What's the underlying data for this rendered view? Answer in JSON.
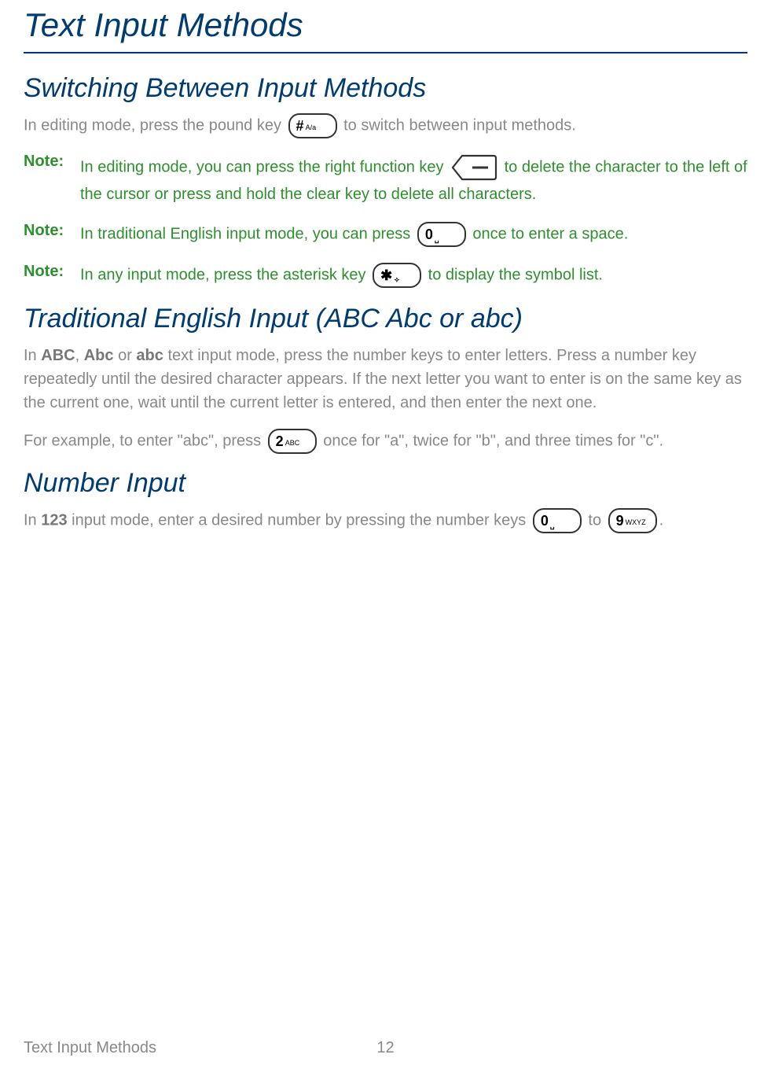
{
  "page": {
    "title": "Text Input Methods",
    "footer_title": "Text Input Methods",
    "page_number": "12"
  },
  "sections": {
    "switching": {
      "heading": "Switching Between Input Methods",
      "intro_pre": "In editing mode, press the pound key ",
      "intro_post": " to switch between input methods.",
      "note1_label": "Note:",
      "note1_pre": "In editing mode, you can press the right function key ",
      "note1_post": " to delete the character to the left of the cursor or press and hold the clear key to delete all characters.",
      "note2_label": "Note:",
      "note2_pre": "In traditional English input mode, you can press ",
      "note2_post": " once to enter a space.",
      "note3_label": "Note:",
      "note3_pre": "In any input mode, press the asterisk key ",
      "note3_post": " to display the symbol list."
    },
    "traditional": {
      "heading": "Traditional English Input (ABC Abc or abc)",
      "para1_pre": "In ",
      "para1_b1": "ABC",
      "para1_mid1": ", ",
      "para1_b2": "Abc",
      "para1_mid2": " or ",
      "para1_b3": "abc",
      "para1_post": " text input mode, press the number keys to enter letters. Press a number key repeatedly until the desired character appears. If the next letter you want to enter is on the same key as the current one, wait until the current letter is entered, and then enter the next one.",
      "para2_pre": "For example, to enter \"abc\", press ",
      "para2_post": " once for \"a\", twice for \"b\", and three times for \"c\"."
    },
    "number": {
      "heading": "Number Input",
      "para_pre": "In ",
      "para_b1": "123",
      "para_mid1": " input mode, enter a desired number by pressing the number keys ",
      "para_mid2": " to ",
      "para_post": "."
    }
  },
  "keys": {
    "pound_main": "#",
    "pound_sub": "A/a",
    "zero_main": "0",
    "zero_sub": "␣",
    "asterisk_main": "✱",
    "asterisk_sub": "✧",
    "two_main": "2",
    "two_sub": "ABC",
    "nine_main": "9",
    "nine_sub": "WXYZ"
  }
}
